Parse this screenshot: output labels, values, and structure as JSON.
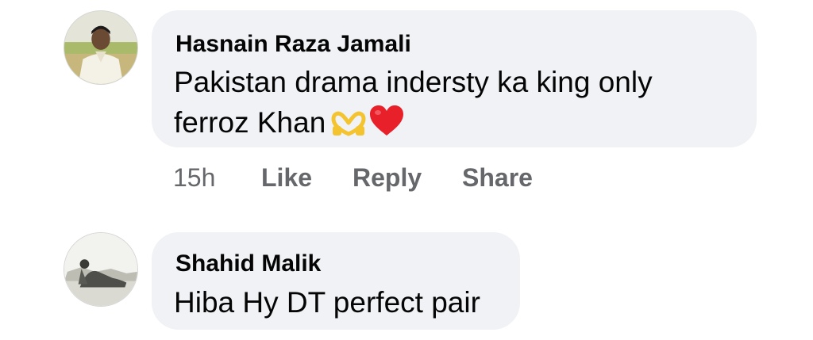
{
  "comments": [
    {
      "author": "Hasnain Raza Jamali",
      "text_line1": "Pakistan drama indersty ka king only",
      "text_line2": "ferroz Khan",
      "emojis": [
        "heart-hands-emoji",
        "red-heart-emoji"
      ],
      "time": "15h",
      "actions": {
        "like": "Like",
        "reply": "Reply",
        "share": "Share"
      }
    },
    {
      "author": "Shahid Malik",
      "text": "Hiba Hy DT perfect pair"
    }
  ],
  "colors": {
    "bubble": "#f0f2f5",
    "text": "#050505",
    "meta": "#65676b",
    "heart": "#e8202a",
    "heart_hands": "#f4c430"
  }
}
